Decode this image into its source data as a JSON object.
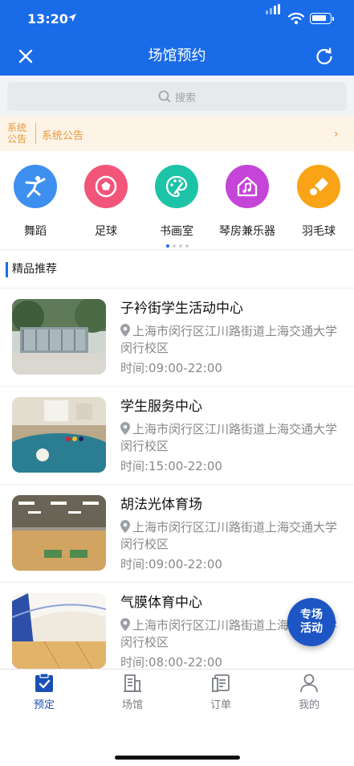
{
  "status_bar": {
    "time": "13:20"
  },
  "nav": {
    "title": "场馆预约",
    "close_icon": "close-icon",
    "refresh_icon": "refresh-icon"
  },
  "search": {
    "placeholder": "搜索"
  },
  "notice": {
    "tag": "系统公告",
    "text": "系统公告"
  },
  "categories": [
    {
      "label": "舞蹈",
      "icon": "dance-icon",
      "color": "#3d8ff0"
    },
    {
      "label": "足球",
      "icon": "football-icon",
      "color": "#f2557a"
    },
    {
      "label": "书画室",
      "icon": "palette-icon",
      "color": "#1dc3a7"
    },
    {
      "label": "琴房兼乐器",
      "icon": "music-room-icon",
      "color": "#c445d8"
    },
    {
      "label": "羽毛球",
      "icon": "badminton-icon",
      "color": "#f9a417"
    }
  ],
  "section": {
    "title": "精品推荐"
  },
  "venues": [
    {
      "name": "子衿街学生活动中心",
      "address": "上海市闵行区江川路街道上海交通大学闵行校区",
      "time": "时间:09:00-22:00"
    },
    {
      "name": "学生服务中心",
      "address": "上海市闵行区江川路街道上海交通大学闵行校区",
      "time": "时间:15:00-22:00"
    },
    {
      "name": "胡法光体育场",
      "address": "上海市闵行区江川路街道上海交通大学闵行校区",
      "time": "时间:09:00-22:00"
    },
    {
      "name": "气膜体育中心",
      "address": "上海市闵行区江川路街道上海交通大学闵行校区",
      "time": "时间:08:00-22:00"
    }
  ],
  "fab": {
    "line1": "专场",
    "line2": "活动"
  },
  "tabs": [
    {
      "label": "预定",
      "icon": "booking-icon"
    },
    {
      "label": "场馆",
      "icon": "venue-icon"
    },
    {
      "label": "订单",
      "icon": "order-icon"
    },
    {
      "label": "我的",
      "icon": "profile-icon"
    }
  ],
  "colors": {
    "brand": "#1a6be8",
    "notice": "#e69a3a",
    "fab": "#1d56c4",
    "tab_active": "#1a4fb5"
  }
}
